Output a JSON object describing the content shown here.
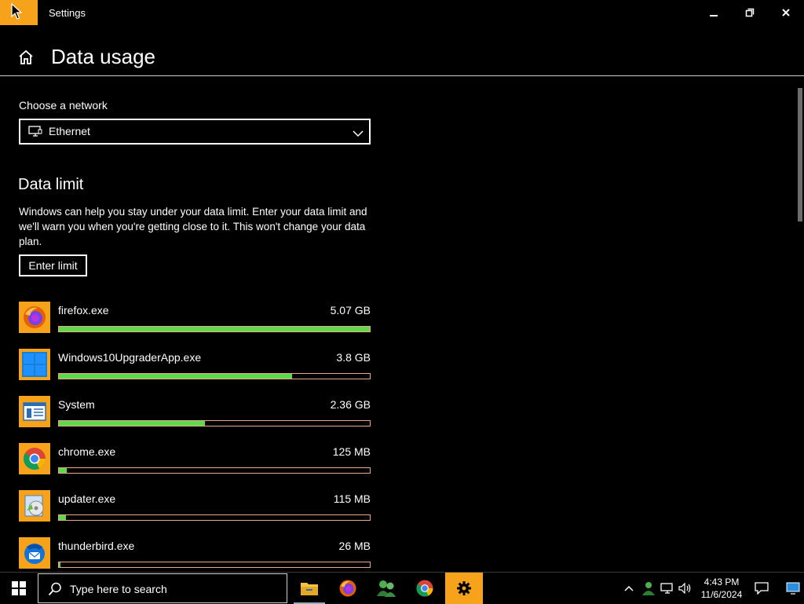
{
  "window": {
    "title": "Settings"
  },
  "header": {
    "title": "Data usage"
  },
  "network": {
    "label": "Choose a network",
    "selected": "Ethernet"
  },
  "data_limit": {
    "title": "Data limit",
    "description": "Windows can help you stay under your data limit. Enter your data limit and we'll warn you when you're getting close to it. This won't change your data plan.",
    "button_label": "Enter limit"
  },
  "apps": [
    {
      "name": "firefox.exe",
      "usage": "5.07 GB",
      "fraction": 1.0,
      "icon": "firefox-icon"
    },
    {
      "name": "Windows10UpgraderApp.exe",
      "usage": "3.8 GB",
      "fraction": 0.75,
      "icon": "windows-upgrader-icon"
    },
    {
      "name": "System",
      "usage": "2.36 GB",
      "fraction": 0.47,
      "icon": "system-icon"
    },
    {
      "name": "chrome.exe",
      "usage": "125 MB",
      "fraction": 0.025,
      "icon": "chrome-icon"
    },
    {
      "name": "updater.exe",
      "usage": "115 MB",
      "fraction": 0.022,
      "icon": "updater-icon"
    },
    {
      "name": "thunderbird.exe",
      "usage": "26 MB",
      "fraction": 0.005,
      "icon": "thunderbird-icon"
    }
  ],
  "taskbar": {
    "search_placeholder": "Type here to search",
    "time": "4:43 PM",
    "date": "11/6/2024"
  },
  "colors": {
    "accent": "#f7a21b",
    "bar_fill": "#5ed94b",
    "bar_border": "#e5a98a"
  }
}
